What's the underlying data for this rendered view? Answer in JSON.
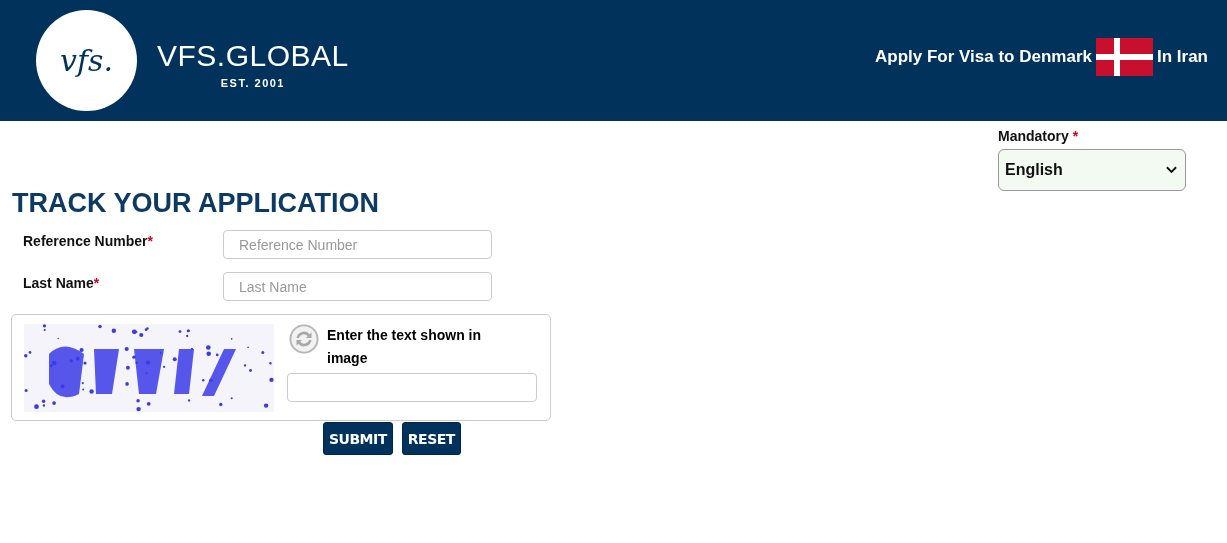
{
  "header": {
    "logo": {
      "monogram": "vfs.",
      "wordmark": "VFS.GLOBAL",
      "tagline": "EST. 2001"
    },
    "apply_text": "Apply For Visa to Denmark",
    "location_text": "In Iran"
  },
  "language": {
    "label": "Mandatory",
    "required_mark": "*",
    "value": "English"
  },
  "title": "TRACK YOUR APPLICATION",
  "fields": [
    {
      "label": "Reference Number",
      "required_mark": "*",
      "placeholder": "Reference Number"
    },
    {
      "label": "Last Name",
      "required_mark": "*",
      "placeholder": "Last Name"
    }
  ],
  "captcha": {
    "prompt": "Enter the text shown in image"
  },
  "buttons": [
    "SUBMIT",
    "RESET"
  ]
}
